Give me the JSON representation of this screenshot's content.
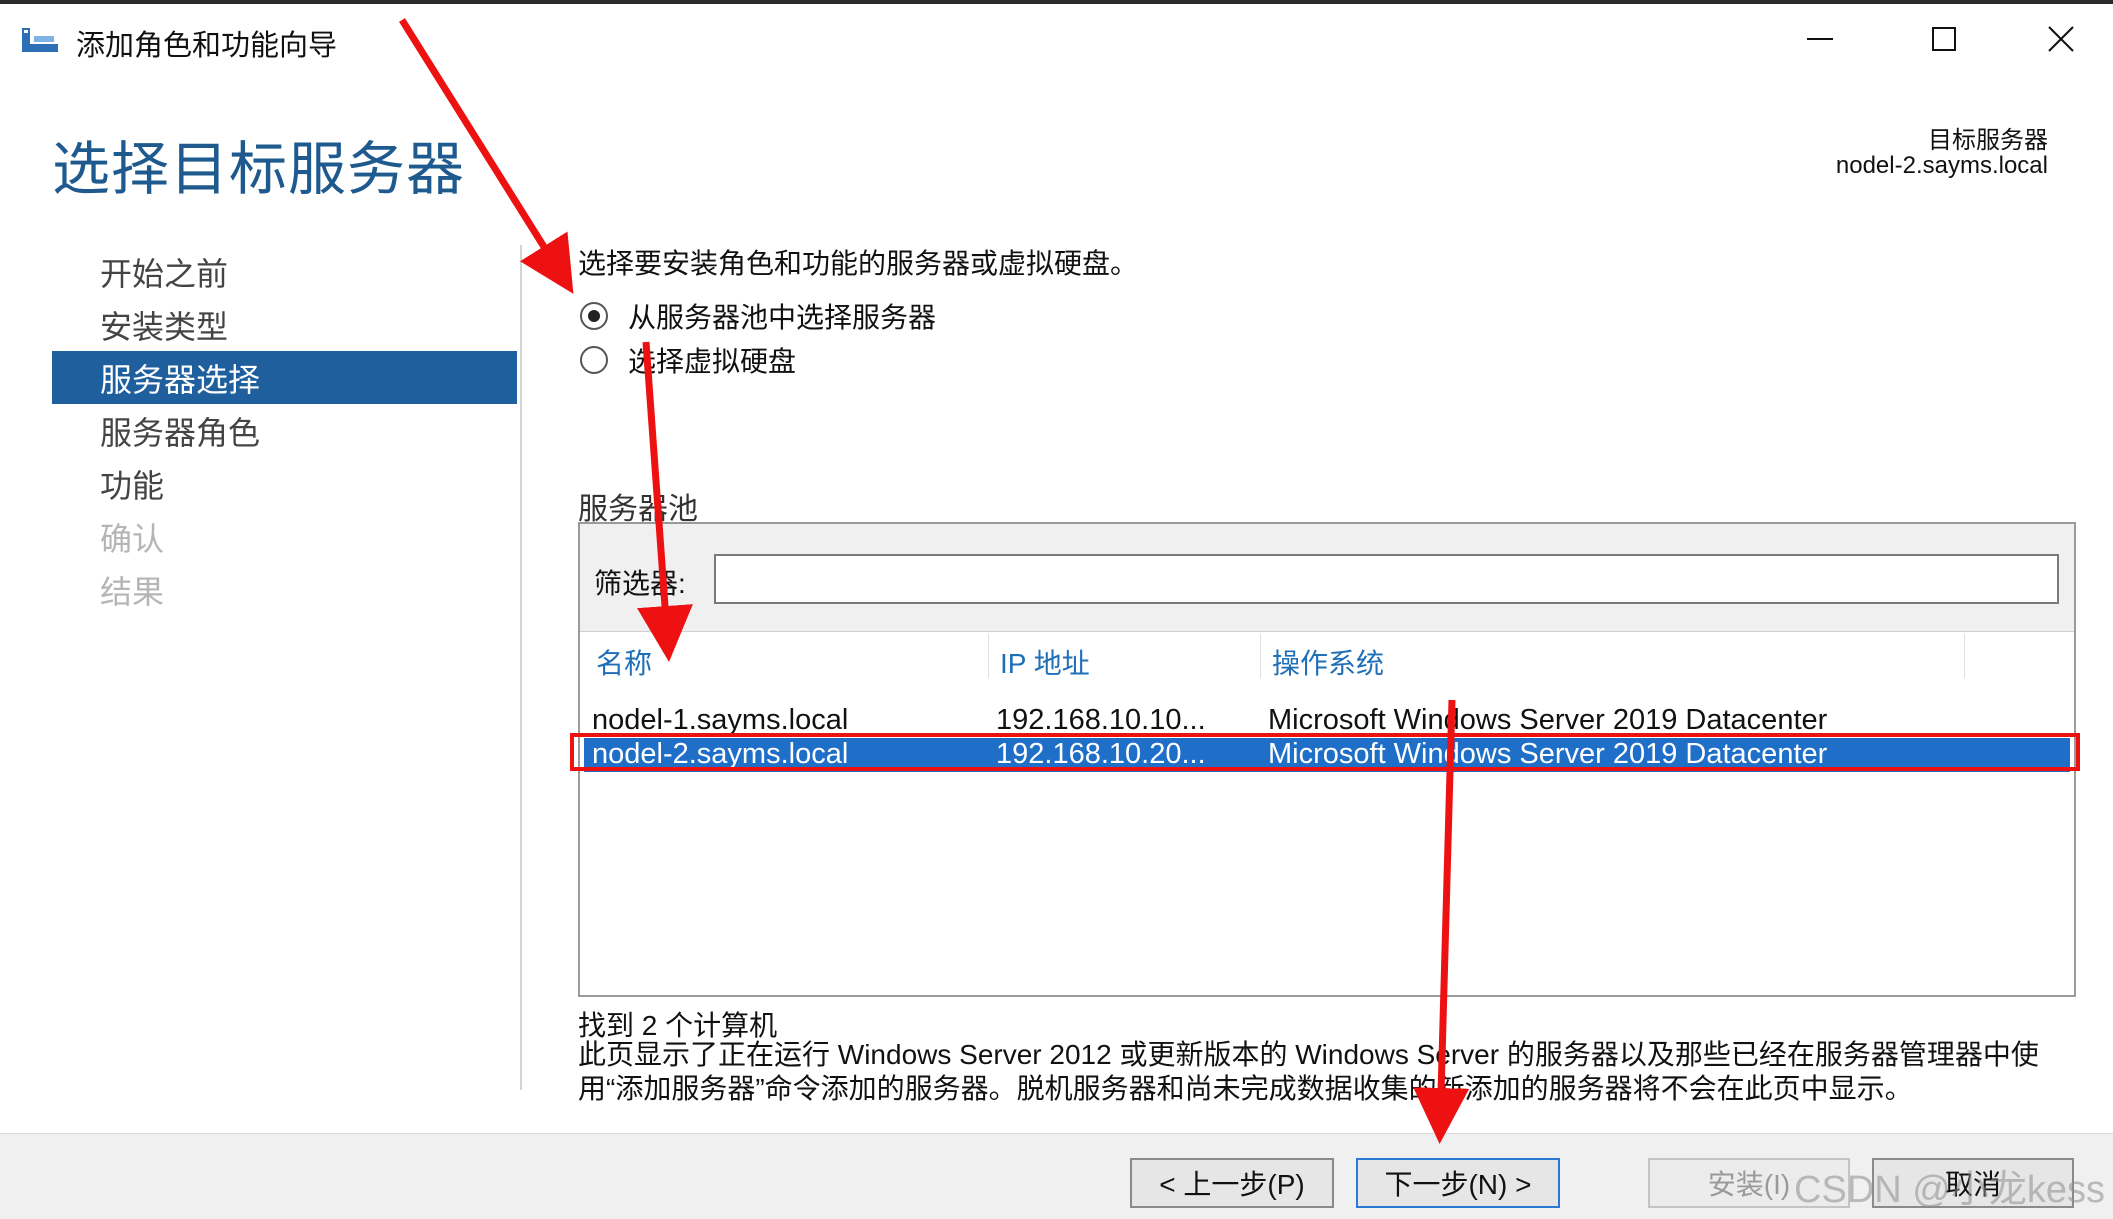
{
  "window": {
    "title": "添加角色和功能向导",
    "controls": {
      "minimize": "minimize-icon",
      "maximize": "maximize-icon",
      "close": "close-icon"
    }
  },
  "page": {
    "title": "选择目标服务器",
    "destination_label": "目标服务器",
    "destination_value": "nodel-2.sayms.local"
  },
  "sidebar": {
    "items": [
      {
        "label": "开始之前",
        "state": "normal"
      },
      {
        "label": "安装类型",
        "state": "normal"
      },
      {
        "label": "服务器选择",
        "state": "active"
      },
      {
        "label": "服务器角色",
        "state": "normal"
      },
      {
        "label": "功能",
        "state": "normal"
      },
      {
        "label": "确认",
        "state": "disabled"
      },
      {
        "label": "结果",
        "state": "disabled"
      }
    ]
  },
  "content": {
    "description": "选择要安装角色和功能的服务器或虚拟硬盘。",
    "radio_pool": "从服务器池中选择服务器",
    "radio_vhd": "选择虚拟硬盘",
    "pool_label": "服务器池",
    "filter_label": "筛选器:",
    "filter_value": "",
    "columns": [
      "名称",
      "IP 地址",
      "操作系统"
    ],
    "rows": [
      {
        "name": "nodel-1.sayms.local",
        "ip": "192.168.10.10...",
        "os": "Microsoft Windows Server 2019 Datacenter"
      },
      {
        "name": "nodel-2.sayms.local",
        "ip": "192.168.10.20...",
        "os": "Microsoft Windows Server 2019 Datacenter"
      }
    ],
    "found": "找到 2 个计算机",
    "note": "此页显示了正在运行 Windows Server 2012 或更新版本的 Windows Server 的服务器以及那些已经在服务器管理器中使用“添加服务器”命令添加的服务器。脱机服务器和尚未完成数据收集的新添加的服务器将不会在此页中显示。"
  },
  "buttons": {
    "prev": "< 上一步(P)",
    "next": "下一步(N) >",
    "install": "安装(I)",
    "cancel": "取消"
  },
  "watermark": "CSDN @小龙kess",
  "colors": {
    "accent": "#1f5f9e",
    "title": "#1e5a8d",
    "selection": "#1f6fc9",
    "annotation": "#ee1111"
  }
}
